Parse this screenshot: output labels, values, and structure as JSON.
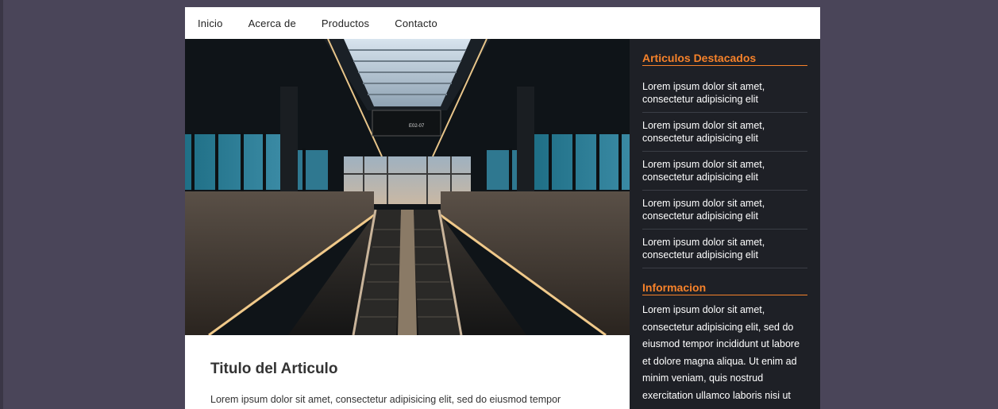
{
  "nav": {
    "items": [
      "Inicio",
      "Acerca de",
      "Productos",
      "Contacto"
    ]
  },
  "hero": {
    "icon": "airport-escalator-photo",
    "sign_text": "E02-07"
  },
  "article": {
    "title": "Titulo del Articulo",
    "text": "Lorem ipsum dolor sit amet, consectetur adipisicing elit, sed do eiusmod tempor"
  },
  "sidebar": {
    "featured_title": "Articulos Destacados",
    "featured_items": [
      "Lorem ipsum dolor sit amet, consectetur adipisicing elit",
      "Lorem ipsum dolor sit amet, consectetur adipisicing elit",
      "Lorem ipsum dolor sit amet, consectetur adipisicing elit",
      "Lorem ipsum dolor sit amet, consectetur adipisicing elit",
      "Lorem ipsum dolor sit amet, consectetur adipisicing elit"
    ],
    "info_title": "Informacion",
    "info_text": "Lorem ipsum dolor sit amet, consectetur adipisicing elit, sed do eiusmod tempor incididunt ut labore et dolore magna aliqua. Ut enim ad minim veniam, quis nostrud exercitation ullamco laboris nisi ut"
  },
  "colors": {
    "background": "#4a4559",
    "accent": "#f7822a",
    "sidebar": "#1e2026"
  }
}
